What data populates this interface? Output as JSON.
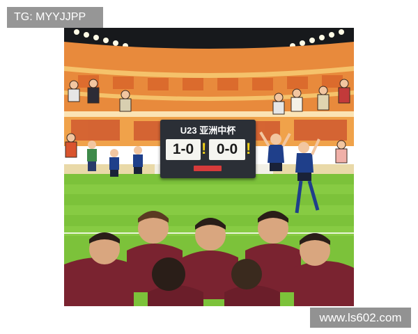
{
  "overlays": {
    "top_left_tag": "TG: MYYJJPP",
    "bottom_right_site": "www.ls602.com"
  },
  "scoreboard": {
    "title": "U23 亚洲中杯",
    "score_left": "1-0",
    "score_right": "0-0",
    "exclamation": "!"
  },
  "colors": {
    "pitch": "#7cc23a",
    "stand_orange": "#e88a3c",
    "night_sky": "#17191c",
    "home_kit_maroon": "#7a2330",
    "away_kit_blue": "#1f3f8a",
    "scoreboard_dark": "#2b2f36"
  }
}
